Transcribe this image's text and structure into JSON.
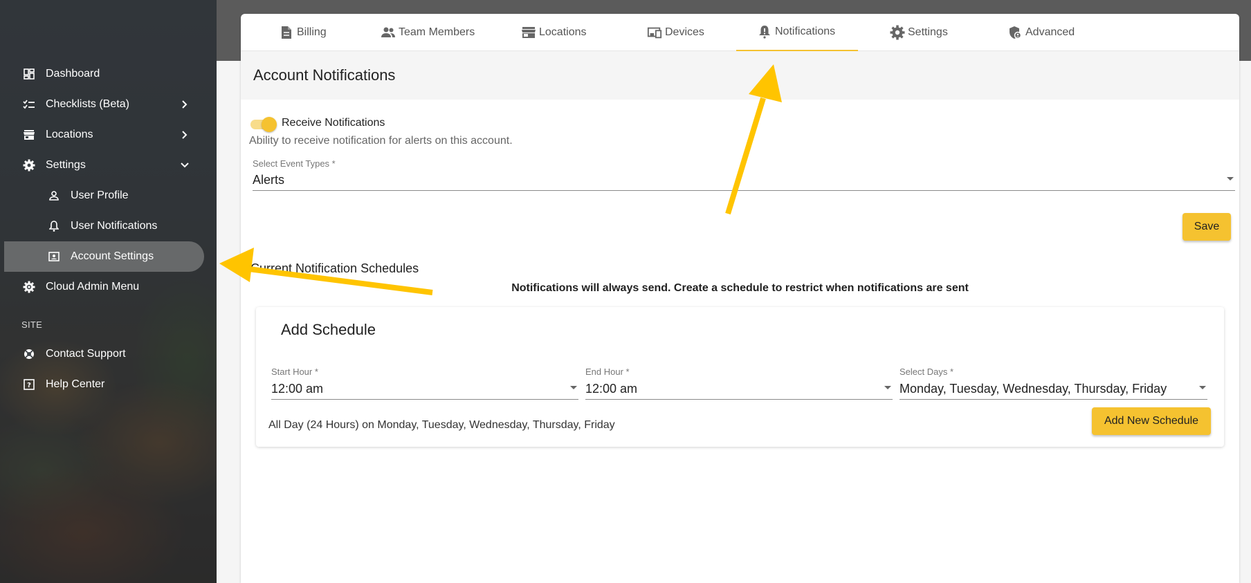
{
  "sidebar": {
    "items": [
      {
        "label": "Dashboard",
        "icon": "dashboard-icon"
      },
      {
        "label": "Checklists (Beta)",
        "icon": "checklist-icon",
        "chevron": "chevron-right-icon"
      },
      {
        "label": "Locations",
        "icon": "store-icon",
        "chevron": "chevron-right-icon"
      },
      {
        "label": "Settings",
        "icon": "gear-icon",
        "chevron": "chevron-down-icon"
      },
      {
        "label": "User Profile",
        "icon": "person-icon"
      },
      {
        "label": "User Notifications",
        "icon": "bell-icon"
      },
      {
        "label": "Account Settings",
        "icon": "account-box-icon",
        "active": true
      },
      {
        "label": "Cloud Admin Menu",
        "icon": "admin-gear-icon"
      }
    ],
    "section_label": "SITE",
    "site_items": [
      {
        "label": "Contact Support",
        "icon": "lifebuoy-icon"
      },
      {
        "label": "Help Center",
        "icon": "help-box-icon"
      }
    ]
  },
  "tabs": [
    {
      "label": "Billing",
      "icon": "document-icon"
    },
    {
      "label": "Team Members",
      "icon": "people-icon"
    },
    {
      "label": "Locations",
      "icon": "store-icon"
    },
    {
      "label": "Devices",
      "icon": "devices-icon"
    },
    {
      "label": "Notifications",
      "icon": "bell-alert-icon",
      "active": true
    },
    {
      "label": "Settings",
      "icon": "gear-icon"
    },
    {
      "label": "Advanced",
      "icon": "shield-icon"
    }
  ],
  "page": {
    "title": "Account Notifications",
    "toggle_label": "Receive Notifications",
    "toggle_on": true,
    "toggle_description": "Ability to receive notification for alerts on this account.",
    "event_types": {
      "label": "Select Event Types *",
      "value": "Alerts"
    },
    "save_label": "Save",
    "schedules_title": "Current Notification Schedules",
    "notice": "Notifications will always send. Create a schedule to restrict when notifications are sent"
  },
  "schedule": {
    "title": "Add Schedule",
    "start": {
      "label": "Start Hour *",
      "value": "12:00 am"
    },
    "end": {
      "label": "End Hour *",
      "value": "12:00 am"
    },
    "days": {
      "label": "Select Days *",
      "value": "Monday, Tuesday, Wednesday, Thursday, Friday"
    },
    "summary": "All Day (24 Hours) on Monday, Tuesday, Wednesday, Thursday, Friday",
    "add_label": "Add New Schedule"
  },
  "colors": {
    "accent": "#f5c230",
    "arrow": "#ffc400"
  }
}
